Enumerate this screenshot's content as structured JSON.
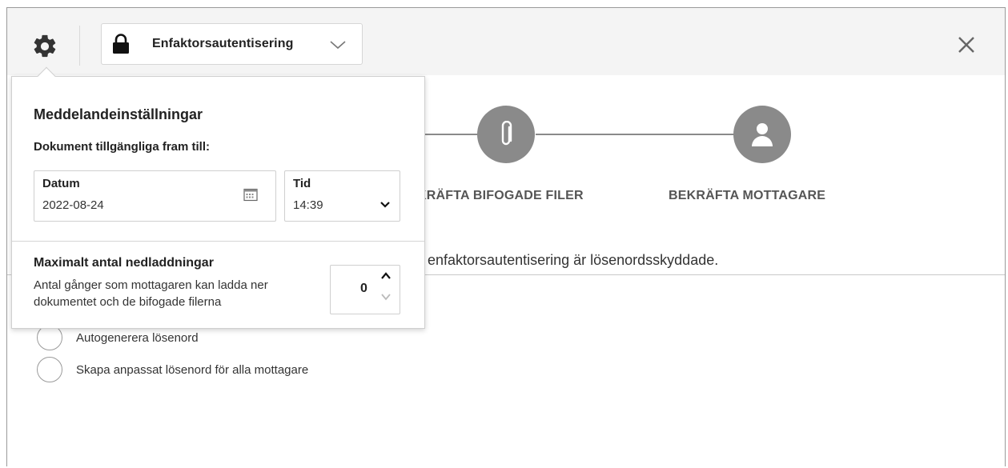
{
  "header": {
    "auth_mode": "Enfaktorsautentisering",
    "icons": [
      "gear-icon",
      "lock-icon",
      "chevron-down-icon",
      "close-icon"
    ]
  },
  "stepper": {
    "steps": [
      {
        "label": "KRÄFTA BIFOGADE FILER",
        "icon": "paperclip-icon"
      },
      {
        "label": "BEKRÄFTA MOTTAGARE",
        "icon": "person-icon"
      }
    ]
  },
  "main": {
    "info_text": "d enfaktorsautentisering är lösenordsskyddade.",
    "radio_options": [
      {
        "label": "Autogenerera lösenord",
        "selected": false
      },
      {
        "label": "Skapa anpassat lösenord för alla mottagare",
        "selected": false
      }
    ]
  },
  "popover": {
    "title": "Meddelandeinställningar",
    "subtitle": "Dokument tillgängliga fram till:",
    "date": {
      "label": "Datum",
      "value": "2022-08-24"
    },
    "time": {
      "label": "Tid",
      "value": "14:39"
    },
    "max_downloads": {
      "title": "Maximalt antal nedladdningar",
      "description": "Antal gånger som mottagaren kan ladda ner dokumentet och de bifogade filerna",
      "value": "0"
    }
  },
  "colors": {
    "step_gray": "#8a8a8a",
    "header_bg": "#f4f4f4",
    "border": "#cfcfcf"
  }
}
